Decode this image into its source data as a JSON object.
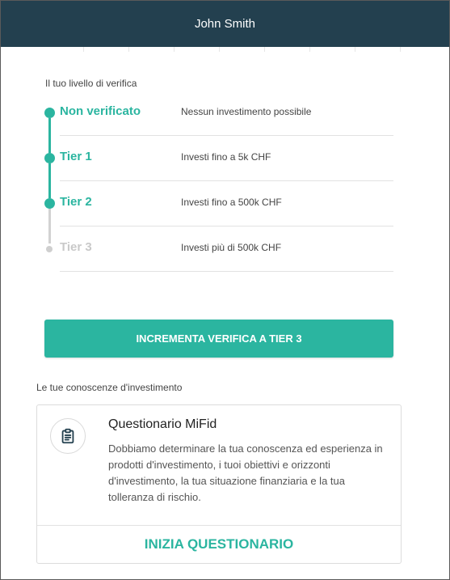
{
  "header": {
    "user_name": "John Smith"
  },
  "verification": {
    "label": "Il tuo livello di verifica",
    "tiers": [
      {
        "name": "Non verificato",
        "description": "Nessun investimento possibile",
        "status": "completed"
      },
      {
        "name": "Tier 1",
        "description": "Investi fino a 5k CHF",
        "status": "completed"
      },
      {
        "name": "Tier 2",
        "description": "Investi fino a 500k CHF",
        "status": "completed"
      },
      {
        "name": "Tier 3",
        "description": "Investi più di 500k CHF",
        "status": "locked"
      }
    ],
    "upgrade_button": "INCREMENTA VERIFICA A TIER 3"
  },
  "knowledge": {
    "label": "Le tue conoscenze d'investimento",
    "card": {
      "icon": "clipboard-icon",
      "title": "Questionario MiFid",
      "body": "Dobbiamo determinare la tua conoscenza ed esperienza in prodotti d'investimento, i tuoi obiettivi e orizzonti d'investimento, la tua situazione finanziaria e la tua tolleranza di rischio.",
      "action": "INIZIA QUESTIONARIO"
    }
  },
  "colors": {
    "header_bg": "#23404f",
    "accent": "#2bb5a0",
    "inactive": "#c9c9c9"
  }
}
